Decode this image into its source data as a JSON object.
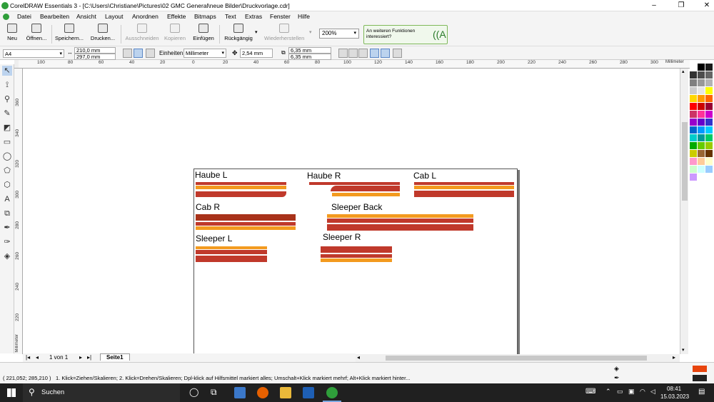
{
  "window": {
    "title": "CorelDRAW Essentials 3 - [C:\\Users\\Christiane\\Pictures\\02 GMC General\\neue Bilder\\Druckvorlage.cdr]",
    "minimize": "–",
    "maximize": "❐",
    "close": "✕"
  },
  "menu": [
    "Datei",
    "Bearbeiten",
    "Ansicht",
    "Layout",
    "Anordnen",
    "Effekte",
    "Bitmaps",
    "Text",
    "Extras",
    "Fenster",
    "Hilfe"
  ],
  "toolbar": {
    "new": "Neu",
    "open": "Öffnen...",
    "save": "Speichern...",
    "print": "Drucken...",
    "cut": "Ausschneiden",
    "copy": "Kopieren",
    "paste": "Einfügen",
    "undo": "Rückgängig",
    "redo": "Wiederherstellen",
    "zoom": "200%",
    "promo": "An weiteren Funktionen interessiert?"
  },
  "propbar": {
    "page_size": "A4",
    "width": "210,0 mm",
    "height": "297,0 mm",
    "units_label": "Einheiten:",
    "units": "Millimeter",
    "nudge": "2,54 mm",
    "dup_x": "6,35 mm",
    "dup_y": "6,35 mm"
  },
  "ruler": {
    "unit": "Millimeter",
    "h_ticks": [
      "100",
      "80",
      "60",
      "40",
      "20",
      "0",
      "20",
      "40",
      "60",
      "80",
      "100",
      "120",
      "140",
      "160",
      "180",
      "200",
      "220",
      "240",
      "260",
      "280",
      "300"
    ],
    "v_ticks": [
      "360",
      "340",
      "320",
      "300",
      "280",
      "260",
      "240",
      "220",
      "200",
      "180"
    ]
  },
  "canvas": {
    "labels": [
      "Haube L",
      "Haube R",
      "Cab L",
      "Cab R",
      "Sleeper Back",
      "Sleeper L",
      "Sleeper R"
    ]
  },
  "pagenav": {
    "count": "1 von 1",
    "tab": "Seite1"
  },
  "status": {
    "coords": "( 221,052; 285,210 )",
    "hint": "1. Klick=Ziehen/Skalieren; 2. Klick=Drehen/Skalieren; Dpl-klick auf Hilfsmittel markiert alles; Umschalt+Klick markiert mehrf; Alt+Klick markiert hinter..."
  },
  "taskbar": {
    "search": "Suchen",
    "time": "08:41",
    "date": "15.03.2023"
  },
  "colors": {
    "orange": "#f39a1f",
    "red": "#c0392b",
    "darkred": "#a8321a",
    "fill_swatch": "#e8450e",
    "outline_swatch": "#222222"
  },
  "palette": [
    "#ffffff",
    "#000000",
    "#1a1a1a",
    "#333333",
    "#4d4d4d",
    "#666666",
    "#808080",
    "#999999",
    "#b3b3b3",
    "#cccccc",
    "#e6e6e6",
    "#ffff00",
    "#ffd700",
    "#ff9900",
    "#ff6600",
    "#ff0000",
    "#cc0000",
    "#990033",
    "#cc3366",
    "#ff3399",
    "#cc00cc",
    "#9900cc",
    "#6600cc",
    "#3333cc",
    "#0066cc",
    "#0099ff",
    "#00ccff",
    "#00cccc",
    "#009999",
    "#00cc66",
    "#00aa00",
    "#66cc00",
    "#99cc00",
    "#cccc00",
    "#996633",
    "#663300",
    "#ff99cc",
    "#ffcc99",
    "#ffffcc",
    "#ccffcc",
    "#ccffff",
    "#99ccff",
    "#cc99ff"
  ]
}
